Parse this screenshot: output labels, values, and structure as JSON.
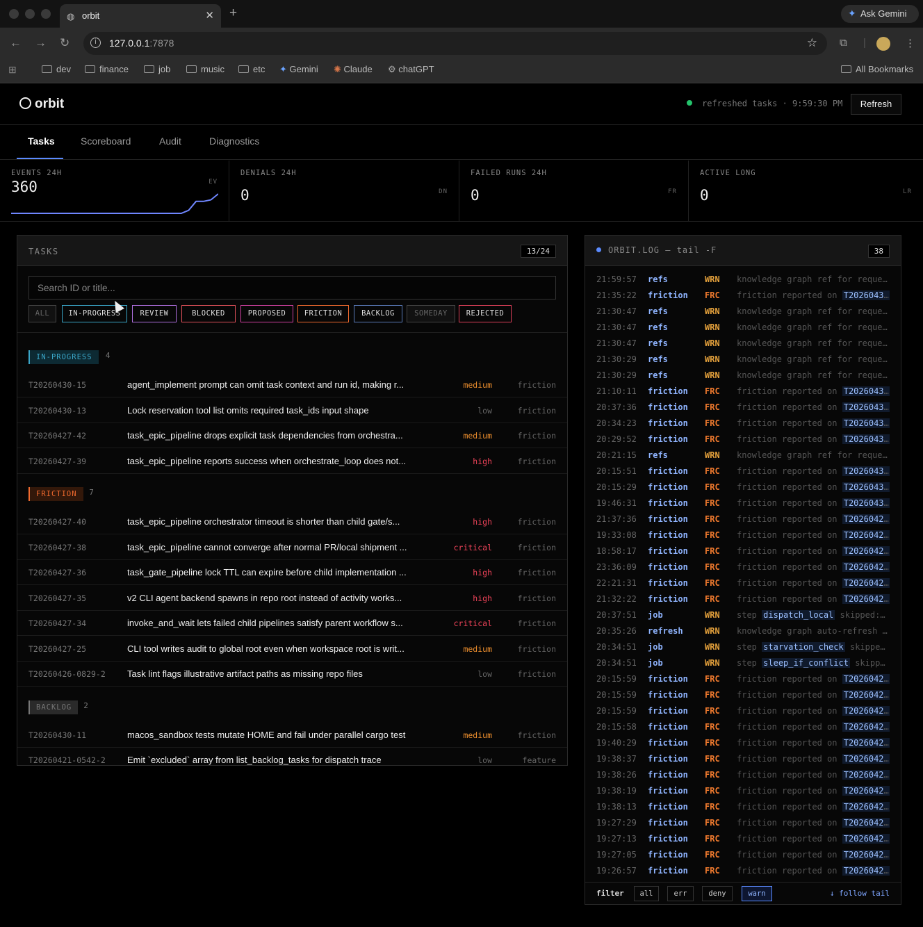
{
  "browser": {
    "tab_title": "orbit",
    "url_host": "127.0.0.1",
    "url_port": ":7878",
    "gemini_label": "Ask Gemini",
    "bookmarks": [
      "dev",
      "finance",
      "job",
      "music",
      "etc",
      "Gemini",
      "Claude",
      "chatGPT"
    ],
    "all_bookmarks": "All Bookmarks"
  },
  "app": {
    "name": "orbit",
    "status_text": "refreshed tasks · 9:59:30 PM",
    "status_color": "#24c36b",
    "refresh_label": "Refresh",
    "tabs": [
      "Tasks",
      "Scoreboard",
      "Audit",
      "Diagnostics"
    ],
    "active_tab": "Tasks"
  },
  "metrics": [
    {
      "label": "EVENTS 24H",
      "value": "360",
      "unit": "EV",
      "sparkline": [
        0,
        0,
        0,
        0,
        0,
        0,
        0,
        0,
        0,
        0,
        0,
        0,
        0,
        0,
        0,
        0,
        0,
        0,
        0,
        0,
        0,
        0,
        0,
        0,
        2,
        8,
        8,
        9,
        13
      ]
    },
    {
      "label": "DENIALS 24H",
      "value": "0",
      "unit": "DN"
    },
    {
      "label": "FAILED RUNS 24H",
      "value": "0",
      "unit": "FR"
    },
    {
      "label": "ACTIVE LONG",
      "value": "0",
      "unit": "LR"
    }
  ],
  "tasks_panel": {
    "title": "TASKS",
    "count": "13/24",
    "search_placeholder": "Search ID or title...",
    "filters": [
      {
        "label": "ALL",
        "color": "#444",
        "active": false
      },
      {
        "label": "IN-PROGRESS",
        "color": "#3aa6c8",
        "active": true
      },
      {
        "label": "REVIEW",
        "color": "#b070e0",
        "active": true
      },
      {
        "label": "BLOCKED",
        "color": "#e0505a",
        "active": true
      },
      {
        "label": "PROPOSED",
        "color": "#d040a0",
        "active": true
      },
      {
        "label": "FRICTION",
        "color": "#f06a2e",
        "active": true
      },
      {
        "label": "BACKLOG",
        "color": "#5a7ab8",
        "active": true
      },
      {
        "label": "SOMEDAY",
        "color": "#444",
        "active": false
      },
      {
        "label": "REJECTED",
        "color": "#e0405a",
        "active": true
      }
    ],
    "groups": [
      {
        "label": "IN-PROGRESS",
        "count": "4",
        "color": "#3aa6c8",
        "bg": "#0d2a33",
        "tasks": [
          {
            "id": "T20260430-15",
            "title": "agent_implement prompt can omit task context and run id, making r...",
            "priority": "medium",
            "tag": "friction"
          },
          {
            "id": "T20260430-13",
            "title": "Lock reservation tool list omits required task_ids input shape",
            "priority": "low",
            "tag": "friction"
          },
          {
            "id": "T20260427-42",
            "title": "task_epic_pipeline drops explicit task dependencies from orchestra...",
            "priority": "medium",
            "tag": "friction"
          },
          {
            "id": "T20260427-39",
            "title": "task_epic_pipeline reports success when orchestrate_loop does not...",
            "priority": "high",
            "tag": "friction"
          }
        ]
      },
      {
        "label": "FRICTION",
        "count": "7",
        "color": "#f06a2e",
        "bg": "#33180a",
        "tasks": [
          {
            "id": "T20260427-40",
            "title": "task_epic_pipeline orchestrator timeout is shorter than child gate/s...",
            "priority": "high",
            "tag": "friction"
          },
          {
            "id": "T20260427-38",
            "title": "task_epic_pipeline cannot converge after normal PR/local shipment ...",
            "priority": "critical",
            "tag": "friction"
          },
          {
            "id": "T20260427-36",
            "title": "task_gate_pipeline lock TTL can expire before child implementation ...",
            "priority": "high",
            "tag": "friction"
          },
          {
            "id": "T20260427-35",
            "title": "v2 CLI agent backend spawns in repo root instead of activity works...",
            "priority": "high",
            "tag": "friction"
          },
          {
            "id": "T20260427-34",
            "title": "invoke_and_wait lets failed child pipelines satisfy parent workflow s...",
            "priority": "critical",
            "tag": "friction"
          },
          {
            "id": "T20260427-25",
            "title": "CLI tool writes audit to global root even when workspace root is writ...",
            "priority": "medium",
            "tag": "friction"
          },
          {
            "id": "T20260426-0829-2",
            "title": "Task lint flags illustrative artifact paths as missing repo files",
            "priority": "low",
            "tag": "friction"
          }
        ]
      },
      {
        "label": "BACKLOG",
        "count": "2",
        "color": "#777",
        "bg": "#2a2a2a",
        "tasks": [
          {
            "id": "T20260430-11",
            "title": "macos_sandbox tests mutate HOME and fail under parallel cargo test",
            "priority": "medium",
            "tag": "friction"
          },
          {
            "id": "T20260421-0542-2",
            "title": "Emit `excluded` array from list_backlog_tasks for dispatch trace",
            "priority": "low",
            "tag": "feature"
          }
        ]
      }
    ]
  },
  "log_panel": {
    "title": "ORBIT.LOG — tail -F",
    "count": "38",
    "entries": [
      {
        "ts": "21:59:57",
        "src": "refs",
        "lvl": "WRN",
        "msg": "knowledge graph ref for reques..."
      },
      {
        "ts": "21:35:22",
        "src": "friction",
        "lvl": "FRC",
        "msg": "friction reported on",
        "ref": "T20260430..."
      },
      {
        "ts": "21:30:47",
        "src": "refs",
        "lvl": "WRN",
        "msg": "knowledge graph ref for reques..."
      },
      {
        "ts": "21:30:47",
        "src": "refs",
        "lvl": "WRN",
        "msg": "knowledge graph ref for reques..."
      },
      {
        "ts": "21:30:47",
        "src": "refs",
        "lvl": "WRN",
        "msg": "knowledge graph ref for reques..."
      },
      {
        "ts": "21:30:29",
        "src": "refs",
        "lvl": "WRN",
        "msg": "knowledge graph ref for reques..."
      },
      {
        "ts": "21:30:29",
        "src": "refs",
        "lvl": "WRN",
        "msg": "knowledge graph ref for reques..."
      },
      {
        "ts": "21:10:11",
        "src": "friction",
        "lvl": "FRC",
        "msg": "friction reported on",
        "ref": "T20260430..."
      },
      {
        "ts": "20:37:36",
        "src": "friction",
        "lvl": "FRC",
        "msg": "friction reported on",
        "ref": "T20260430..."
      },
      {
        "ts": "20:34:23",
        "src": "friction",
        "lvl": "FRC",
        "msg": "friction reported on",
        "ref": "T20260430..."
      },
      {
        "ts": "20:29:52",
        "src": "friction",
        "lvl": "FRC",
        "msg": "friction reported on",
        "ref": "T20260430..."
      },
      {
        "ts": "20:21:15",
        "src": "refs",
        "lvl": "WRN",
        "msg": "knowledge graph ref for reques..."
      },
      {
        "ts": "20:15:51",
        "src": "friction",
        "lvl": "FRC",
        "msg": "friction reported on",
        "ref": "T20260430..."
      },
      {
        "ts": "20:15:29",
        "src": "friction",
        "lvl": "FRC",
        "msg": "friction reported on",
        "ref": "T20260430..."
      },
      {
        "ts": "19:46:31",
        "src": "friction",
        "lvl": "FRC",
        "msg": "friction reported on",
        "ref": "T20260430..."
      },
      {
        "ts": "21:37:36",
        "src": "friction",
        "lvl": "FRC",
        "msg": "friction reported on",
        "ref": "T20260428..."
      },
      {
        "ts": "19:33:08",
        "src": "friction",
        "lvl": "FRC",
        "msg": "friction reported on",
        "ref": "T20260428..."
      },
      {
        "ts": "18:58:17",
        "src": "friction",
        "lvl": "FRC",
        "msg": "friction reported on",
        "ref": "T20260428..."
      },
      {
        "ts": "23:36:09",
        "src": "friction",
        "lvl": "FRC",
        "msg": "friction reported on",
        "ref": "T20260427..."
      },
      {
        "ts": "22:21:31",
        "src": "friction",
        "lvl": "FRC",
        "msg": "friction reported on",
        "ref": "T20260427..."
      },
      {
        "ts": "21:32:22",
        "src": "friction",
        "lvl": "FRC",
        "msg": "friction reported on",
        "ref": "T20260427..."
      },
      {
        "ts": "20:37:51",
        "src": "job",
        "lvl": "WRN",
        "msg": "step",
        "ref": "dispatch_local",
        "tail": "skipped: ..."
      },
      {
        "ts": "20:35:26",
        "src": "refresh",
        "lvl": "WRN",
        "msg": "knowledge graph auto-refresh f..."
      },
      {
        "ts": "20:34:51",
        "src": "job",
        "lvl": "WRN",
        "msg": "step",
        "ref": "starvation_check",
        "tail": "skipped..."
      },
      {
        "ts": "20:34:51",
        "src": "job",
        "lvl": "WRN",
        "msg": "step",
        "ref": "sleep_if_conflict",
        "tail": "skippe..."
      },
      {
        "ts": "20:15:59",
        "src": "friction",
        "lvl": "FRC",
        "msg": "friction reported on",
        "ref": "T20260427..."
      },
      {
        "ts": "20:15:59",
        "src": "friction",
        "lvl": "FRC",
        "msg": "friction reported on",
        "ref": "T20260427..."
      },
      {
        "ts": "20:15:59",
        "src": "friction",
        "lvl": "FRC",
        "msg": "friction reported on",
        "ref": "T20260427..."
      },
      {
        "ts": "20:15:58",
        "src": "friction",
        "lvl": "FRC",
        "msg": "friction reported on",
        "ref": "T20260427..."
      },
      {
        "ts": "19:40:29",
        "src": "friction",
        "lvl": "FRC",
        "msg": "friction reported on",
        "ref": "T20260427..."
      },
      {
        "ts": "19:38:37",
        "src": "friction",
        "lvl": "FRC",
        "msg": "friction reported on",
        "ref": "T20260427..."
      },
      {
        "ts": "19:38:26",
        "src": "friction",
        "lvl": "FRC",
        "msg": "friction reported on",
        "ref": "T20260427..."
      },
      {
        "ts": "19:38:19",
        "src": "friction",
        "lvl": "FRC",
        "msg": "friction reported on",
        "ref": "T20260427..."
      },
      {
        "ts": "19:38:13",
        "src": "friction",
        "lvl": "FRC",
        "msg": "friction reported on",
        "ref": "T20260427..."
      },
      {
        "ts": "19:27:29",
        "src": "friction",
        "lvl": "FRC",
        "msg": "friction reported on",
        "ref": "T20260427..."
      },
      {
        "ts": "19:27:13",
        "src": "friction",
        "lvl": "FRC",
        "msg": "friction reported on",
        "ref": "T20260427..."
      },
      {
        "ts": "19:27:05",
        "src": "friction",
        "lvl": "FRC",
        "msg": "friction reported on",
        "ref": "T20260427..."
      },
      {
        "ts": "19:26:57",
        "src": "friction",
        "lvl": "FRC",
        "msg": "friction reported on",
        "ref": "T20260427..."
      }
    ],
    "filter_label": "filter",
    "filters": [
      {
        "label": "all",
        "active": false
      },
      {
        "label": "err",
        "active": false
      },
      {
        "label": "deny",
        "active": false
      },
      {
        "label": "warn",
        "active": true
      }
    ],
    "follow_label": "↓ follow tail"
  }
}
